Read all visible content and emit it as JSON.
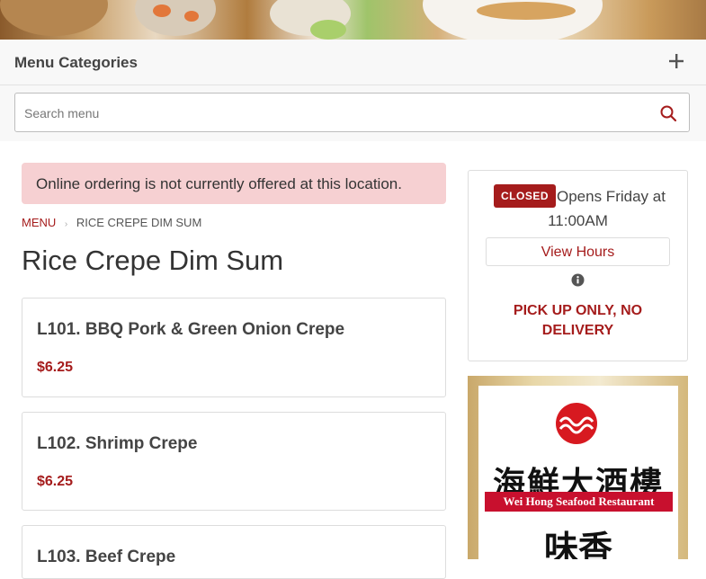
{
  "header": {
    "categories_title": "Menu Categories"
  },
  "search": {
    "placeholder": "Search menu",
    "value": ""
  },
  "alert": {
    "text": "Online ordering is not currently offered at this location."
  },
  "breadcrumb": {
    "menu": "MENU",
    "current": "RICE CREPE DIM SUM"
  },
  "page_title": "Rice Crepe Dim Sum",
  "items": [
    {
      "name": "L101. BBQ Pork & Green Onion Crepe",
      "price": "$6.25"
    },
    {
      "name": "L102. Shrimp Crepe",
      "price": "$6.25"
    },
    {
      "name": "L103. Beef Crepe",
      "price": ""
    }
  ],
  "status_card": {
    "badge": "CLOSED",
    "opens_line1": "Opens Friday at",
    "opens_line2": "11:00AM",
    "view_hours": "View Hours",
    "pickup_note": "PICK UP ONLY, NO DELIVERY"
  },
  "logo": {
    "chinese_name": "海鮮大酒樓",
    "english_name": "Wei Hong Seafood Restaurant",
    "chinese_tagline": "味香"
  },
  "colors": {
    "accent": "#a51c1c",
    "alert_bg": "#f6d0d2",
    "border": "#dddddd"
  },
  "icons": {
    "plus": "plus-icon",
    "search": "search-icon",
    "info": "info-icon"
  }
}
